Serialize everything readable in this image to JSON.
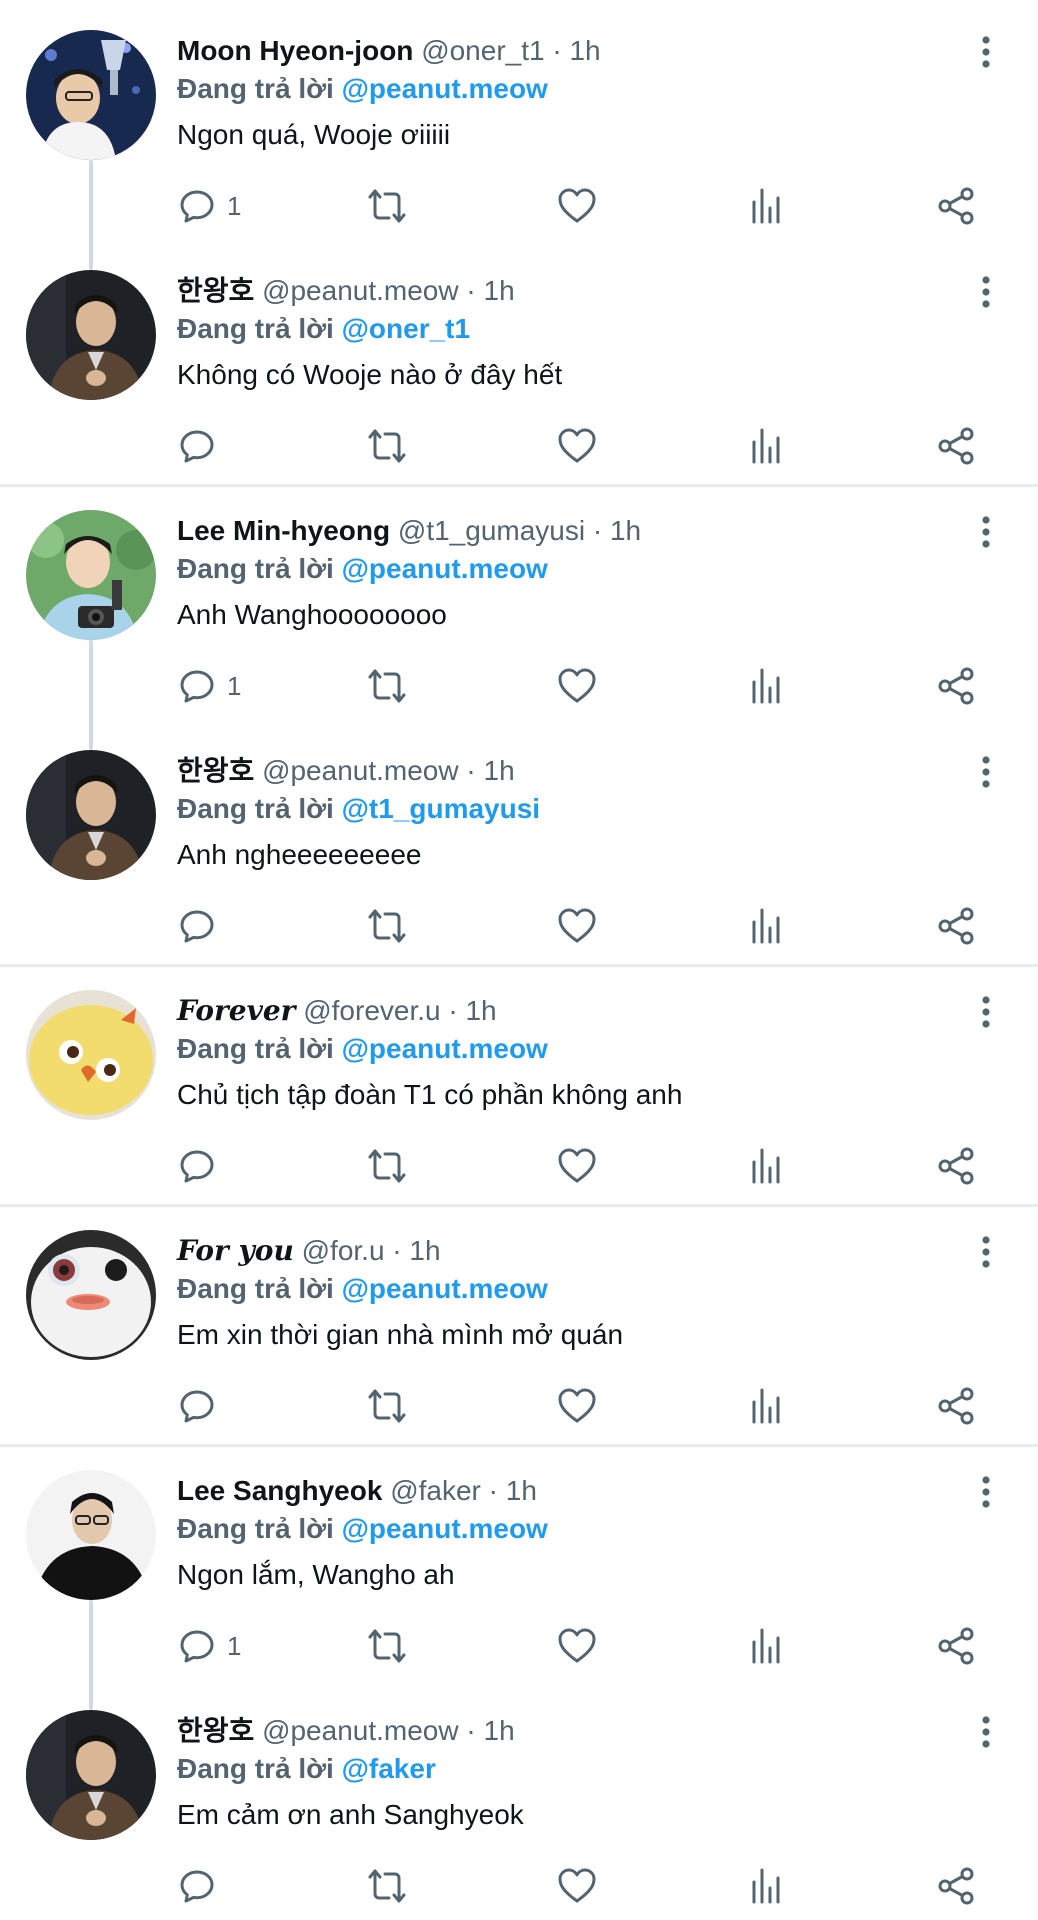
{
  "tweets": [
    {
      "name": "Moon Hyeon-joon",
      "name_style": "bold",
      "handle": "@oner_t1",
      "dot": "·",
      "time": "1h",
      "replying_label": "Đang trả lời",
      "replying_to": "@peanut.meow",
      "text": "Ngon quá, Wooje ơiiiii",
      "reply_count": "1",
      "avatar": "oner"
    },
    {
      "name": "한왕호",
      "name_style": "bold",
      "handle": "@peanut.meow",
      "dot": "·",
      "time": "1h",
      "replying_label": "Đang trả lời",
      "replying_to": "@oner_t1",
      "text": "Không có Wooje nào ở đây hết",
      "reply_count": "",
      "avatar": "peanut"
    },
    {
      "name": "Lee Min-hyeong",
      "name_style": "bold",
      "handle": "@t1_gumayusi",
      "dot": "·",
      "time": "1h",
      "replying_label": "Đang trả lời",
      "replying_to": "@peanut.meow",
      "text": "Anh Wanghoooooooo",
      "reply_count": "1",
      "avatar": "gumayusi"
    },
    {
      "name": "한왕호",
      "name_style": "bold",
      "handle": "@peanut.meow",
      "dot": "·",
      "time": "1h",
      "replying_label": "Đang trả lời",
      "replying_to": "@t1_gumayusi",
      "text": "Anh ngheeeeeeeee",
      "reply_count": "",
      "avatar": "peanut"
    },
    {
      "name": "Forever",
      "name_style": "script",
      "handle": "@forever.u",
      "dot": "·",
      "time": "1h",
      "replying_label": "Đang trả lời",
      "replying_to": "@peanut.meow",
      "text": "Chủ tịch tập đoàn T1 có phần không anh",
      "reply_count": "",
      "avatar": "forever"
    },
    {
      "name": "For you",
      "name_style": "script",
      "handle": "@for.u",
      "dot": "·",
      "time": "1h",
      "replying_label": "Đang trả lời",
      "replying_to": "@peanut.meow",
      "text": "Em xin thời gian nhà mình mở quán",
      "reply_count": "",
      "avatar": "foryou"
    },
    {
      "name": "Lee Sanghyeok",
      "name_style": "bold",
      "handle": "@faker",
      "dot": "·",
      "time": "1h",
      "replying_label": "Đang trả lời",
      "replying_to": "@peanut.meow",
      "text": "Ngon lắm, Wangho ah",
      "reply_count": "1",
      "avatar": "faker"
    },
    {
      "name": "한왕호",
      "name_style": "bold",
      "handle": "@peanut.meow",
      "dot": "·",
      "time": "1h",
      "replying_label": "Đang trả lời",
      "replying_to": "@faker",
      "text": "Em cảm ơn anh Sanghyeok",
      "reply_count": "",
      "avatar": "peanut"
    }
  ],
  "icons": {
    "reply": "reply-icon",
    "retweet": "retweet-icon",
    "like": "heart-icon",
    "views": "views-chart-icon",
    "share": "share-icon",
    "more": "more-vertical-icon"
  },
  "colors": {
    "link": "#1d9bf0",
    "secondary": "#536471",
    "text": "#0f1419",
    "divider": "#e6ecf0",
    "thread_line": "#cfd9de"
  }
}
